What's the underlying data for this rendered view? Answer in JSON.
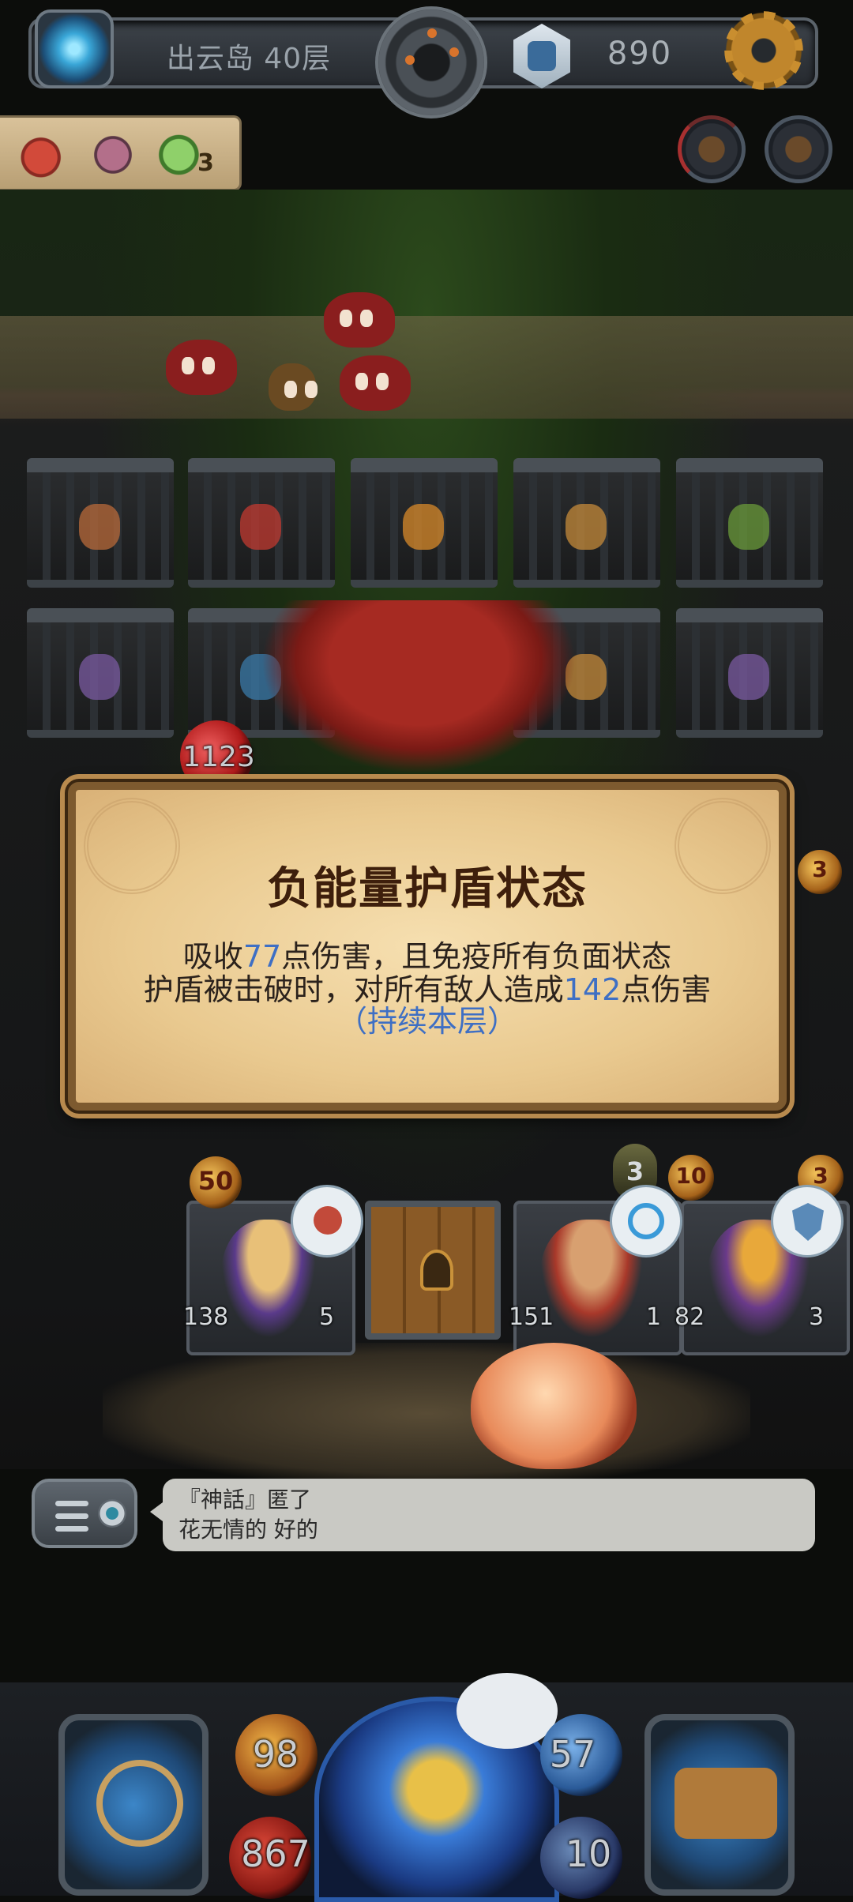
{
  "hud": {
    "floor_label": "出云岛 40层",
    "gem_count": "890"
  },
  "buffs": {
    "cloud_count": "3"
  },
  "board": {
    "boss_hp": "1123",
    "heroes": [
      {
        "attack_badge": "50",
        "hp": "138",
        "armor": "5"
      },
      {
        "attack_badge": "10",
        "hp": "151",
        "armor": "1",
        "cooldown": "3"
      },
      {
        "attack_badge": "3",
        "hp": "82",
        "armor": "3"
      }
    ],
    "right_edge_counter": "3"
  },
  "modal": {
    "title": "负能量护盾状态",
    "line1_prefix": "吸收",
    "line1_value": "77",
    "line1_suffix": "点伤害，且免疫所有负面状态",
    "line2_prefix": "护盾被击破时，对所有敌人造成",
    "line2_value": "142",
    "line2_suffix": "点伤害",
    "duration": "（持续本层）"
  },
  "chat": {
    "line1": "『神話』匿了",
    "line2_name": "花无情的",
    "line2_msg": "好的"
  },
  "bottom": {
    "attack": "98",
    "hp": "867",
    "defense": "57",
    "mana": "10"
  },
  "colors": {
    "accent_blue": "#3e6fc4",
    "modal_paper": "#e9c98f",
    "modal_title": "#3e1f0c"
  }
}
